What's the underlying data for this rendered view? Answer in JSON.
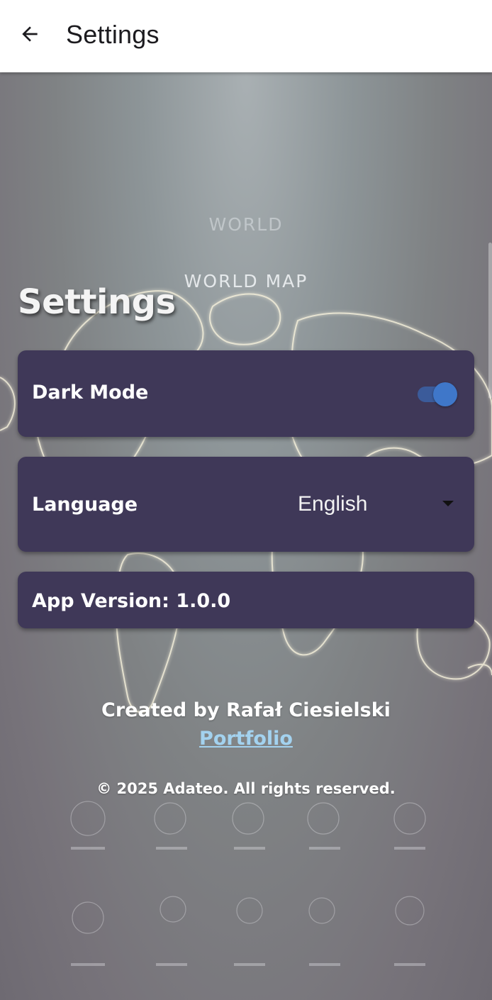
{
  "app_bar": {
    "title": "Settings",
    "back_icon": "arrow-left-icon"
  },
  "background": {
    "title_small": "WORLD",
    "title_large": "WORLD MAP"
  },
  "page": {
    "heading": "Settings"
  },
  "settings": {
    "dark_mode": {
      "label": "Dark Mode",
      "enabled": true
    },
    "language": {
      "label": "Language",
      "selected": "English"
    },
    "app_version": {
      "label": "App Version: 1.0.0"
    }
  },
  "footer": {
    "created_by": "Created by Rafał Ciesielski",
    "portfolio_link": "Portfolio",
    "copyright": "© 2025 Adateo. All rights reserved."
  },
  "colors": {
    "card": "#3f3858",
    "toggle_thumb": "#3f77c9",
    "toggle_track": "#3b5b9a",
    "link": "#a3d2ef"
  }
}
